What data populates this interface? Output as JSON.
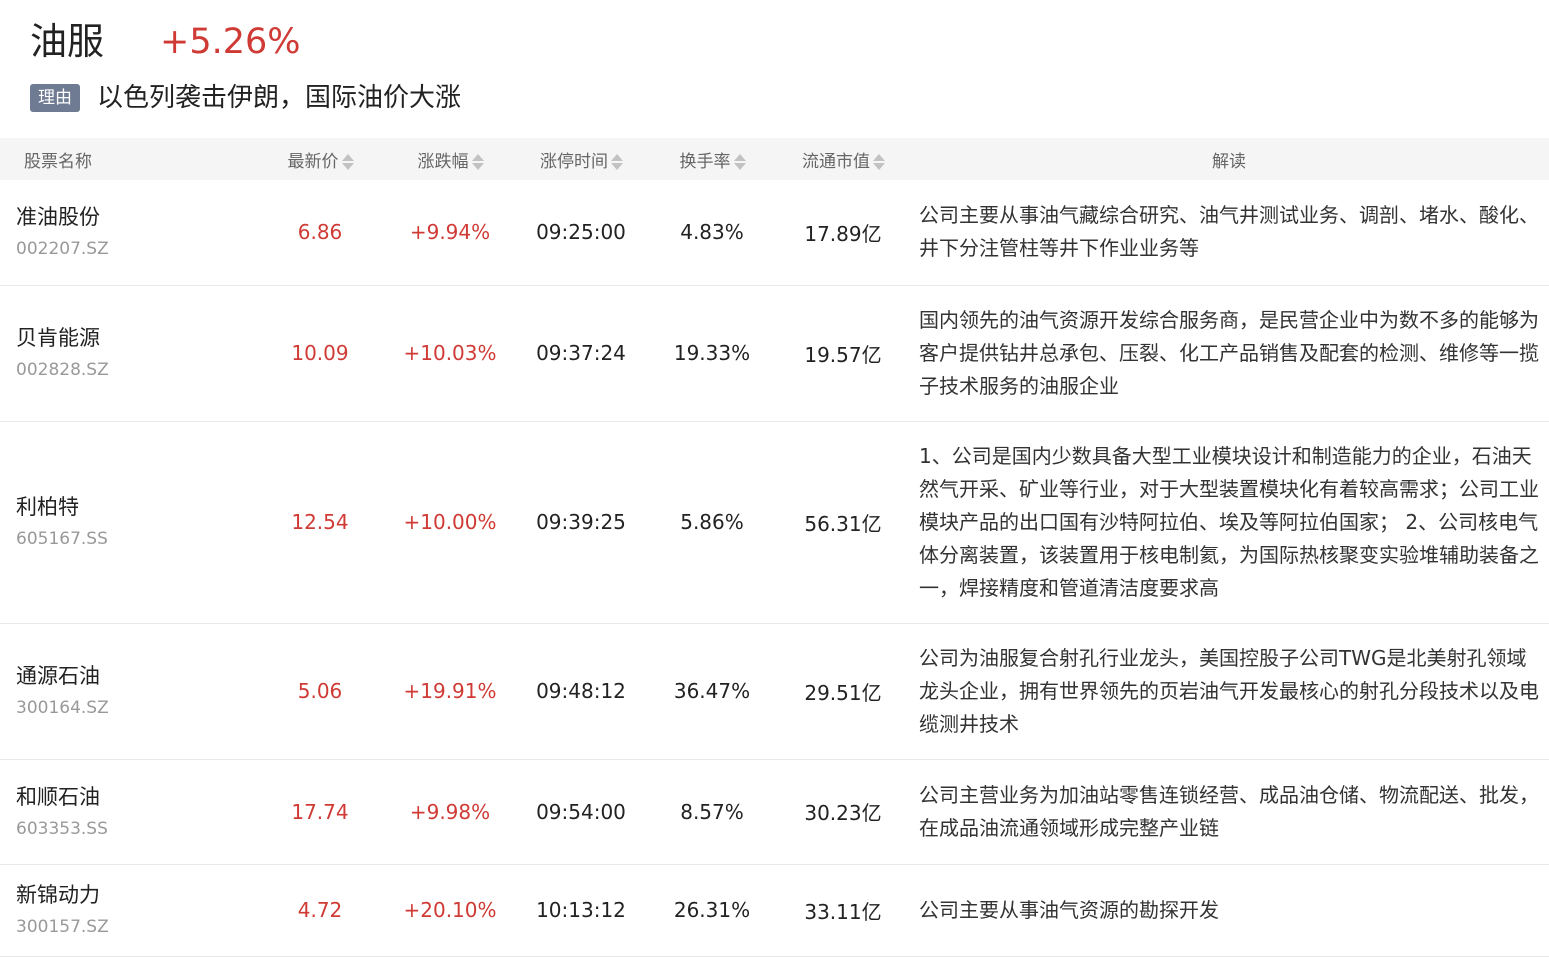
{
  "sector": {
    "name": "油服",
    "change": "+5.26%",
    "reason_tag": "理由",
    "reason": "以色列袭击伊朗，国际油价大涨"
  },
  "columns": {
    "name": "股票名称",
    "price": "最新价",
    "change": "涨跌幅",
    "limit_time": "涨停时间",
    "turnover": "换手率",
    "market_cap": "流通市值",
    "analysis": "解读"
  },
  "rows": [
    {
      "name": "准油股份",
      "code": "002207.SZ",
      "price": "6.86",
      "change": "+9.94%",
      "limit_time": "09:25:00",
      "turnover": "4.83%",
      "market_cap": "17.89亿",
      "analysis": "公司主要从事油气藏综合研究、油气井测试业务、调剖、堵水、酸化、井下分注管柱等井下作业业务等"
    },
    {
      "name": "贝肯能源",
      "code": "002828.SZ",
      "price": "10.09",
      "change": "+10.03%",
      "limit_time": "09:37:24",
      "turnover": "19.33%",
      "market_cap": "19.57亿",
      "analysis": "国内领先的油气资源开发综合服务商，是民营企业中为数不多的能够为客户提供钻井总承包、压裂、化工产品销售及配套的检测、维修等一揽子技术服务的油服企业"
    },
    {
      "name": "利柏特",
      "code": "605167.SS",
      "price": "12.54",
      "change": "+10.00%",
      "limit_time": "09:39:25",
      "turnover": "5.86%",
      "market_cap": "56.31亿",
      "analysis": "1、公司是国内少数具备大型工业模块设计和制造能力的企业，石油天然气开采、矿业等行业，对于大型装置模块化有着较高需求；公司工业模块产品的出口国有沙特阿拉伯、埃及等阿拉伯国家； 2、公司核电气体分离装置，该装置用于核电制氦，为国际热核聚变实验堆辅助装备之一，焊接精度和管道清洁度要求高"
    },
    {
      "name": "通源石油",
      "code": "300164.SZ",
      "price": "5.06",
      "change": "+19.91%",
      "limit_time": "09:48:12",
      "turnover": "36.47%",
      "market_cap": "29.51亿",
      "analysis": "公司为油服复合射孔行业龙头，美国控股子公司TWG是北美射孔领域龙头企业，拥有世界领先的页岩油气开发最核心的射孔分段技术以及电缆测井技术"
    },
    {
      "name": "和顺石油",
      "code": "603353.SS",
      "price": "17.74",
      "change": "+9.98%",
      "limit_time": "09:54:00",
      "turnover": "8.57%",
      "market_cap": "30.23亿",
      "analysis": "公司主营业务为加油站零售连锁经营、成品油仓储、物流配送、批发，在成品油流通领域形成完整产业链"
    },
    {
      "name": "新锦动力",
      "code": "300157.SZ",
      "price": "4.72",
      "change": "+20.10%",
      "limit_time": "10:13:12",
      "turnover": "26.31%",
      "market_cap": "33.11亿",
      "analysis": "公司主要从事油气资源的勘探开发"
    }
  ],
  "colors": {
    "up_red": "#d03a35",
    "tag_bg": "#6f7a93",
    "header_bg": "#f5f5f5",
    "muted": "#999999"
  },
  "icons": {
    "sort": "sort-updown-icon"
  }
}
